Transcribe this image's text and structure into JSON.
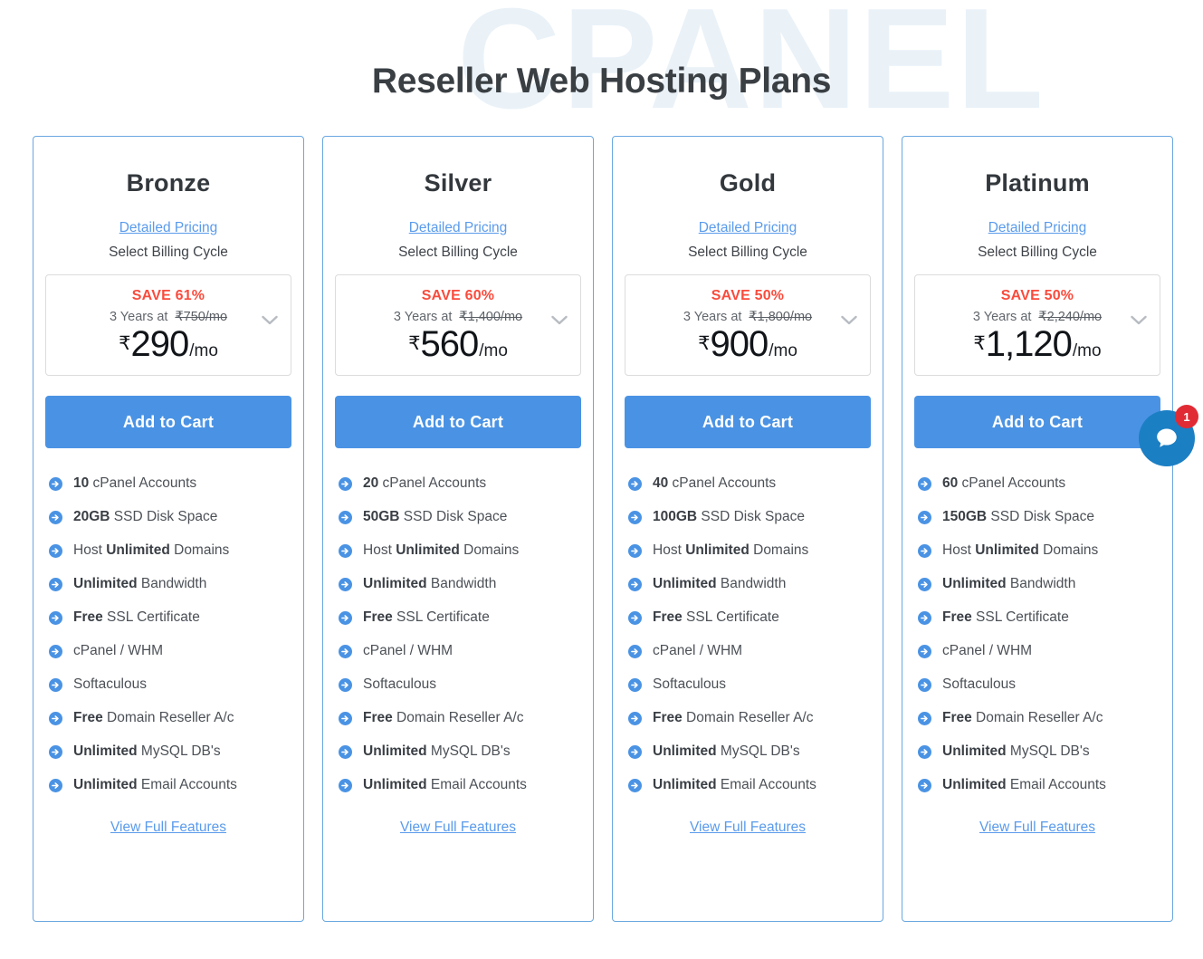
{
  "page": {
    "title": "Reseller Web Hosting Plans",
    "watermark": "CPANEL",
    "accent_blue": "#4a93e4",
    "link_blue": "#5a9bec",
    "save_red": "#fa4b3c",
    "badge_red": "#e02b35",
    "card_border": "#69a7e0",
    "watermark_color": "#eaf2f8"
  },
  "common": {
    "detailed_pricing_label": "Detailed Pricing",
    "billing_cycle_label": "Select Billing Cycle",
    "add_to_cart_label": "Add to Cart",
    "view_full_features_label": "View Full Features",
    "per_mo_suffix": "/mo",
    "rupee_symbol": "₹",
    "chevron_icon": "chevron-down-icon",
    "feature_icon": "arrow-circle-right-icon"
  },
  "plans": [
    {
      "name": "Bronze",
      "save_text": "SAVE 61%",
      "term": "3 Years at",
      "old_price": "₹750/mo",
      "price_amount": "290",
      "features": [
        {
          "bold": "10",
          "rest": " cPanel Accounts"
        },
        {
          "bold": "20GB",
          "rest": " SSD Disk Space"
        },
        {
          "pre": "Host ",
          "bold": "Unlimited",
          "rest": " Domains"
        },
        {
          "bold": "Unlimited",
          "rest": " Bandwidth"
        },
        {
          "bold": "Free",
          "rest": " SSL Certificate"
        },
        {
          "bold": "",
          "rest": "cPanel / WHM"
        },
        {
          "bold": "",
          "rest": "Softaculous"
        },
        {
          "bold": "Free",
          "rest": " Domain Reseller A/c"
        },
        {
          "bold": "Unlimited",
          "rest": " MySQL DB's"
        },
        {
          "bold": "Unlimited",
          "rest": " Email Accounts"
        }
      ]
    },
    {
      "name": "Silver",
      "save_text": "SAVE 60%",
      "term": "3 Years at",
      "old_price": "₹1,400/mo",
      "price_amount": "560",
      "features": [
        {
          "bold": "20",
          "rest": " cPanel Accounts"
        },
        {
          "bold": "50GB",
          "rest": " SSD Disk Space"
        },
        {
          "pre": "Host ",
          "bold": "Unlimited",
          "rest": " Domains"
        },
        {
          "bold": "Unlimited",
          "rest": " Bandwidth"
        },
        {
          "bold": "Free",
          "rest": " SSL Certificate"
        },
        {
          "bold": "",
          "rest": "cPanel / WHM"
        },
        {
          "bold": "",
          "rest": "Softaculous"
        },
        {
          "bold": "Free",
          "rest": " Domain Reseller A/c"
        },
        {
          "bold": "Unlimited",
          "rest": " MySQL DB's"
        },
        {
          "bold": "Unlimited",
          "rest": " Email Accounts"
        }
      ]
    },
    {
      "name": "Gold",
      "save_text": "SAVE 50%",
      "term": "3 Years at",
      "old_price": "₹1,800/mo",
      "price_amount": "900",
      "features": [
        {
          "bold": "40",
          "rest": " cPanel Accounts"
        },
        {
          "bold": "100GB",
          "rest": " SSD Disk Space"
        },
        {
          "pre": "Host ",
          "bold": "Unlimited",
          "rest": " Domains"
        },
        {
          "bold": "Unlimited",
          "rest": " Bandwidth"
        },
        {
          "bold": "Free",
          "rest": " SSL Certificate"
        },
        {
          "bold": "",
          "rest": "cPanel / WHM"
        },
        {
          "bold": "",
          "rest": "Softaculous"
        },
        {
          "bold": "Free",
          "rest": " Domain Reseller A/c"
        },
        {
          "bold": "Unlimited",
          "rest": " MySQL DB's"
        },
        {
          "bold": "Unlimited",
          "rest": " Email Accounts"
        }
      ]
    },
    {
      "name": "Platinum",
      "save_text": "SAVE 50%",
      "term": "3 Years at",
      "old_price": "₹2,240/mo",
      "price_amount": "1,120",
      "features": [
        {
          "bold": "60",
          "rest": " cPanel Accounts"
        },
        {
          "bold": "150GB",
          "rest": " SSD Disk Space"
        },
        {
          "pre": "Host ",
          "bold": "Unlimited",
          "rest": " Domains"
        },
        {
          "bold": "Unlimited",
          "rest": " Bandwidth"
        },
        {
          "bold": "Free",
          "rest": " SSL Certificate"
        },
        {
          "bold": "",
          "rest": "cPanel / WHM"
        },
        {
          "bold": "",
          "rest": "Softaculous"
        },
        {
          "bold": "Free",
          "rest": " Domain Reseller A/c"
        },
        {
          "bold": "Unlimited",
          "rest": " MySQL DB's"
        },
        {
          "bold": "Unlimited",
          "rest": " Email Accounts"
        }
      ]
    }
  ],
  "chat_widget": {
    "badge_count": "1",
    "icon": "chat-bubble-icon"
  }
}
